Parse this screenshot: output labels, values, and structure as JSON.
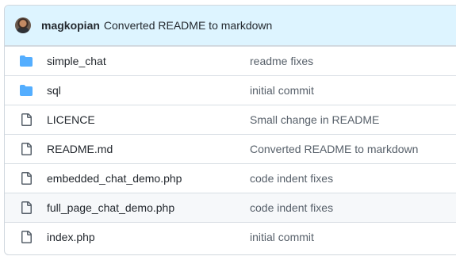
{
  "commit": {
    "author": "magkopian",
    "message": "Converted README to markdown"
  },
  "files": [
    {
      "name": "simple_chat",
      "type": "folder",
      "icon": "folder-icon",
      "message": "readme fixes"
    },
    {
      "name": "sql",
      "type": "folder",
      "icon": "folder-icon",
      "message": "initial commit"
    },
    {
      "name": "LICENCE",
      "type": "file",
      "icon": "file-icon",
      "message": "Small change in README"
    },
    {
      "name": "README.md",
      "type": "file",
      "icon": "file-icon",
      "message": "Converted README to markdown"
    },
    {
      "name": "embedded_chat_demo.php",
      "type": "file",
      "icon": "file-icon",
      "message": "code indent fixes"
    },
    {
      "name": "full_page_chat_demo.php",
      "type": "file",
      "icon": "file-icon",
      "message": "code indent fixes"
    },
    {
      "name": "index.php",
      "type": "file",
      "icon": "file-icon",
      "message": "initial commit"
    }
  ],
  "colors": {
    "header_bg": "#ddf4ff",
    "folder": "#54aeff",
    "file": "#57606a",
    "hover_row": "#f6f8fa"
  }
}
